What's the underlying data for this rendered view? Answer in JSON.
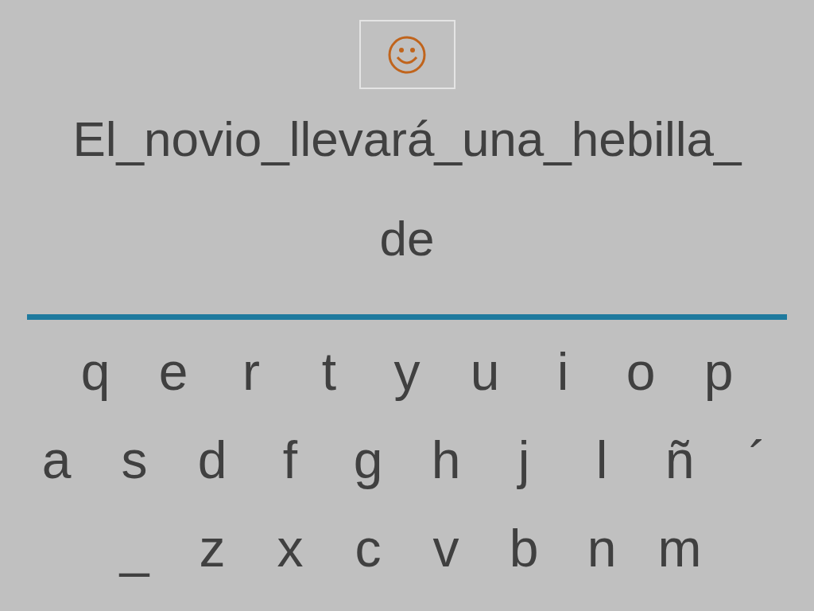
{
  "sentence": {
    "lines": [
      "El_novio_llevará_una_hebilla_",
      "de"
    ]
  },
  "keyboard": {
    "rows": [
      [
        "q",
        "e",
        "r",
        "t",
        "y",
        "u",
        "i",
        "o",
        "p"
      ],
      [
        "a",
        "s",
        "d",
        "f",
        "g",
        "h",
        "j",
        "l",
        "ñ",
        "´"
      ],
      [
        "_",
        "z",
        "x",
        "c",
        "v",
        "b",
        "n",
        "m"
      ]
    ]
  }
}
